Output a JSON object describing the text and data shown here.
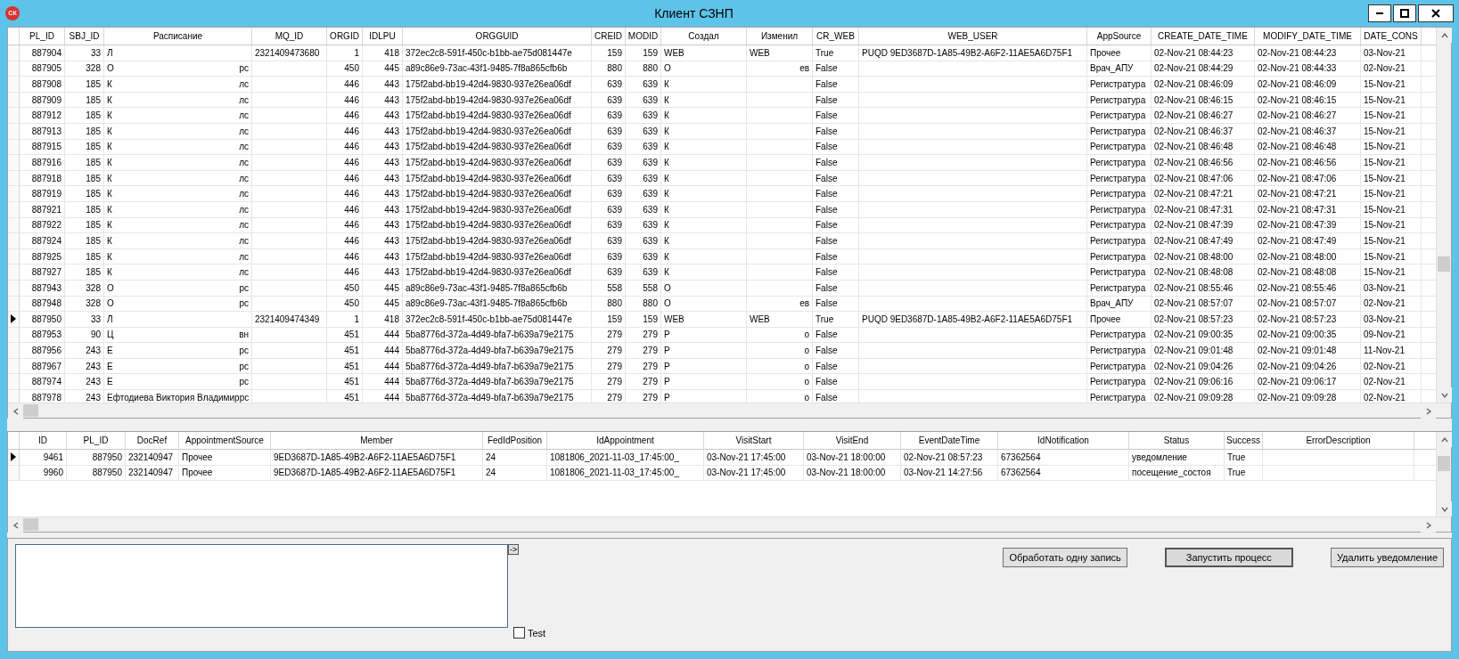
{
  "window": {
    "title": "Клиент СЗНП",
    "app_badge": "СК"
  },
  "top_grid": {
    "columns": [
      "PL_ID",
      "SBJ_ID",
      "Расписание",
      "MQ_ID",
      "ORGID",
      "IDLPU",
      "ORGGUID",
      "CREID",
      "MODID",
      "Создал",
      "Изменил",
      "CR_WEB",
      "WEB_USER",
      "AppSource",
      "CREATE_DATE_TIME",
      "MODIFY_DATE_TIME",
      "DATE_CONS"
    ],
    "rows": [
      {
        "selected": false,
        "cells": [
          "887904",
          "33",
          {
            "start": "Л"
          },
          "2321409473680",
          "1",
          "418",
          "372ec2c8-591f-450c-b1bb-ae75d081447e",
          "159",
          "159",
          {
            "start": "WEB"
          },
          {
            "start": "WEB"
          },
          "True",
          "PUQD 9ED3687D-1A85-49B2-A6F2-11AE5A6D75F1",
          "Прочее",
          "02-Nov-21 08:44:23",
          "02-Nov-21 08:44:23",
          "03-Nov-21"
        ]
      },
      {
        "selected": false,
        "cells": [
          "887905",
          "328",
          {
            "start": "О",
            "end": "рс"
          },
          null,
          "450",
          "445",
          "a89c86e9-73ac-43f1-9485-7f8a865cfb6b",
          "880",
          "880",
          {
            "start": "О"
          },
          {
            "end": "ев"
          },
          "False",
          null,
          "Врач_АПУ",
          "02-Nov-21 08:44:29",
          "02-Nov-21 08:44:33",
          "02-Nov-21"
        ]
      },
      {
        "selected": false,
        "cells": [
          "887908",
          "185",
          {
            "start": "К",
            "end": "лс"
          },
          null,
          "446",
          "443",
          "175f2abd-bb19-42d4-9830-937e26ea06df",
          "639",
          "639",
          {
            "start": "К"
          },
          null,
          "False",
          null,
          "Регистратура",
          "02-Nov-21 08:46:09",
          "02-Nov-21 08:46:09",
          "15-Nov-21"
        ]
      },
      {
        "selected": false,
        "cells": [
          "887909",
          "185",
          {
            "start": "К",
            "end": "лс"
          },
          null,
          "446",
          "443",
          "175f2abd-bb19-42d4-9830-937e26ea06df",
          "639",
          "639",
          {
            "start": "К"
          },
          null,
          "False",
          null,
          "Регистратура",
          "02-Nov-21 08:46:15",
          "02-Nov-21 08:46:15",
          "15-Nov-21"
        ]
      },
      {
        "selected": false,
        "cells": [
          "887912",
          "185",
          {
            "start": "К",
            "end": "лс"
          },
          null,
          "446",
          "443",
          "175f2abd-bb19-42d4-9830-937e26ea06df",
          "639",
          "639",
          {
            "start": "К"
          },
          null,
          "False",
          null,
          "Регистратура",
          "02-Nov-21 08:46:27",
          "02-Nov-21 08:46:27",
          "15-Nov-21"
        ]
      },
      {
        "selected": false,
        "cells": [
          "887913",
          "185",
          {
            "start": "К",
            "end": "лс"
          },
          null,
          "446",
          "443",
          "175f2abd-bb19-42d4-9830-937e26ea06df",
          "639",
          "639",
          {
            "start": "К"
          },
          null,
          "False",
          null,
          "Регистратура",
          "02-Nov-21 08:46:37",
          "02-Nov-21 08:46:37",
          "15-Nov-21"
        ]
      },
      {
        "selected": false,
        "cells": [
          "887915",
          "185",
          {
            "start": "К",
            "end": "лс"
          },
          null,
          "446",
          "443",
          "175f2abd-bb19-42d4-9830-937e26ea06df",
          "639",
          "639",
          {
            "start": "К"
          },
          null,
          "False",
          null,
          "Регистратура",
          "02-Nov-21 08:46:48",
          "02-Nov-21 08:46:48",
          "15-Nov-21"
        ]
      },
      {
        "selected": false,
        "cells": [
          "887916",
          "185",
          {
            "start": "К",
            "end": "лс"
          },
          null,
          "446",
          "443",
          "175f2abd-bb19-42d4-9830-937e26ea06df",
          "639",
          "639",
          {
            "start": "К"
          },
          null,
          "False",
          null,
          "Регистратура",
          "02-Nov-21 08:46:56",
          "02-Nov-21 08:46:56",
          "15-Nov-21"
        ]
      },
      {
        "selected": false,
        "cells": [
          "887918",
          "185",
          {
            "start": "К",
            "end": "лс"
          },
          null,
          "446",
          "443",
          "175f2abd-bb19-42d4-9830-937e26ea06df",
          "639",
          "639",
          {
            "start": "К"
          },
          null,
          "False",
          null,
          "Регистратура",
          "02-Nov-21 08:47:06",
          "02-Nov-21 08:47:06",
          "15-Nov-21"
        ]
      },
      {
        "selected": false,
        "cells": [
          "887919",
          "185",
          {
            "start": "К",
            "end": "лс"
          },
          null,
          "446",
          "443",
          "175f2abd-bb19-42d4-9830-937e26ea06df",
          "639",
          "639",
          {
            "start": "К"
          },
          null,
          "False",
          null,
          "Регистратура",
          "02-Nov-21 08:47:21",
          "02-Nov-21 08:47:21",
          "15-Nov-21"
        ]
      },
      {
        "selected": false,
        "cells": [
          "887921",
          "185",
          {
            "start": "К",
            "end": "лс"
          },
          null,
          "446",
          "443",
          "175f2abd-bb19-42d4-9830-937e26ea06df",
          "639",
          "639",
          {
            "start": "К"
          },
          null,
          "False",
          null,
          "Регистратура",
          "02-Nov-21 08:47:31",
          "02-Nov-21 08:47:31",
          "15-Nov-21"
        ]
      },
      {
        "selected": false,
        "cells": [
          "887922",
          "185",
          {
            "start": "К",
            "end": "лс"
          },
          null,
          "446",
          "443",
          "175f2abd-bb19-42d4-9830-937e26ea06df",
          "639",
          "639",
          {
            "start": "К"
          },
          null,
          "False",
          null,
          "Регистратура",
          "02-Nov-21 08:47:39",
          "02-Nov-21 08:47:39",
          "15-Nov-21"
        ]
      },
      {
        "selected": false,
        "cells": [
          "887924",
          "185",
          {
            "start": "К",
            "end": "лс"
          },
          null,
          "446",
          "443",
          "175f2abd-bb19-42d4-9830-937e26ea06df",
          "639",
          "639",
          {
            "start": "К"
          },
          null,
          "False",
          null,
          "Регистратура",
          "02-Nov-21 08:47:49",
          "02-Nov-21 08:47:49",
          "15-Nov-21"
        ]
      },
      {
        "selected": false,
        "cells": [
          "887925",
          "185",
          {
            "start": "К",
            "end": "лс"
          },
          null,
          "446",
          "443",
          "175f2abd-bb19-42d4-9830-937e26ea06df",
          "639",
          "639",
          {
            "start": "К"
          },
          null,
          "False",
          null,
          "Регистратура",
          "02-Nov-21 08:48:00",
          "02-Nov-21 08:48:00",
          "15-Nov-21"
        ]
      },
      {
        "selected": false,
        "cells": [
          "887927",
          "185",
          {
            "start": "К",
            "end": "лс"
          },
          null,
          "446",
          "443",
          "175f2abd-bb19-42d4-9830-937e26ea06df",
          "639",
          "639",
          {
            "start": "К"
          },
          null,
          "False",
          null,
          "Регистратура",
          "02-Nov-21 08:48:08",
          "02-Nov-21 08:48:08",
          "15-Nov-21"
        ]
      },
      {
        "selected": false,
        "cells": [
          "887943",
          "328",
          {
            "start": "О",
            "end": "рс"
          },
          null,
          "450",
          "445",
          "a89c86e9-73ac-43f1-9485-7f8a865cfb6b",
          "558",
          "558",
          {
            "start": "О"
          },
          null,
          "False",
          null,
          "Регистратура",
          "02-Nov-21 08:55:46",
          "02-Nov-21 08:55:46",
          "03-Nov-21"
        ]
      },
      {
        "selected": false,
        "cells": [
          "887948",
          "328",
          {
            "start": "О",
            "end": "рс"
          },
          null,
          "450",
          "445",
          "a89c86e9-73ac-43f1-9485-7f8a865cfb6b",
          "880",
          "880",
          {
            "start": "О"
          },
          {
            "end": "ев"
          },
          "False",
          null,
          "Врач_АПУ",
          "02-Nov-21 08:57:07",
          "02-Nov-21 08:57:07",
          "02-Nov-21"
        ]
      },
      {
        "selected": true,
        "cells": [
          "887950",
          "33",
          {
            "start": "Л"
          },
          "2321409474349",
          "1",
          "418",
          "372ec2c8-591f-450c-b1bb-ae75d081447e",
          "159",
          "159",
          {
            "start": "WEB"
          },
          {
            "start": "WEB"
          },
          "True",
          "PUQD 9ED3687D-1A85-49B2-A6F2-11AE5A6D75F1",
          "Прочее",
          "02-Nov-21 08:57:23",
          "02-Nov-21 08:57:23",
          "03-Nov-21"
        ]
      },
      {
        "selected": false,
        "cells": [
          "887953",
          "90",
          {
            "start": "Ц",
            "end": "вн"
          },
          null,
          "451",
          "444",
          "5ba8776d-372a-4d49-bfa7-b639a79e2175",
          "279",
          "279",
          {
            "start": "Р"
          },
          {
            "end": "о"
          },
          "False",
          null,
          "Регистратура",
          "02-Nov-21 09:00:35",
          "02-Nov-21 09:00:35",
          "09-Nov-21"
        ]
      },
      {
        "selected": false,
        "cells": [
          "887956",
          "243",
          {
            "start": "Е",
            "end": "рс"
          },
          null,
          "451",
          "444",
          "5ba8776d-372a-4d49-bfa7-b639a79e2175",
          "279",
          "279",
          {
            "start": "Р"
          },
          {
            "end": "о"
          },
          "False",
          null,
          "Регистратура",
          "02-Nov-21 09:01:48",
          "02-Nov-21 09:01:48",
          "11-Nov-21"
        ]
      },
      {
        "selected": false,
        "cells": [
          "887967",
          "243",
          {
            "start": "Е",
            "end": "рс"
          },
          null,
          "451",
          "444",
          "5ba8776d-372a-4d49-bfa7-b639a79e2175",
          "279",
          "279",
          {
            "start": "Р"
          },
          {
            "end": "о"
          },
          "False",
          null,
          "Регистратура",
          "02-Nov-21 09:04:26",
          "02-Nov-21 09:04:26",
          "02-Nov-21"
        ]
      },
      {
        "selected": false,
        "cells": [
          "887974",
          "243",
          {
            "start": "Е",
            "end": "рс"
          },
          null,
          "451",
          "444",
          "5ba8776d-372a-4d49-bfa7-b639a79e2175",
          "279",
          "279",
          {
            "start": "Р"
          },
          {
            "end": "о"
          },
          "False",
          null,
          "Регистратура",
          "02-Nov-21 09:06:16",
          "02-Nov-21 09:06:17",
          "02-Nov-21"
        ]
      },
      {
        "selected": false,
        "cells": [
          "887978",
          "243",
          {
            "start": "Ефтодиева Виктория Владимир",
            "end": "рс"
          },
          null,
          "451",
          "444",
          "5ba8776d-372a-4d49-bfa7-b639a79e2175",
          "279",
          "279",
          {
            "start": "Р"
          },
          {
            "end": "о"
          },
          "False",
          null,
          "Регистратура",
          "02-Nov-21 09:09:28",
          "02-Nov-21 09:09:28",
          "02-Nov-21"
        ]
      }
    ]
  },
  "bottom_grid": {
    "columns": [
      "ID",
      "PL_ID",
      "DocRef",
      "AppointmentSource",
      "Member",
      "FedIdPosition",
      "IdAppointment",
      "VisitStart",
      "VisitEnd",
      "EventDateTime",
      "IdNotification",
      "Status",
      "Success",
      "ErrorDescription"
    ],
    "rows": [
      {
        "selected": true,
        "cells": [
          "9461",
          "887950",
          "232140947",
          "Прочее",
          "9ED3687D-1A85-49B2-A6F2-11AE5A6D75F1",
          "24",
          "1081806_2021-11-03_17:45:00_",
          "03-Nov-21 17:45:00",
          "03-Nov-21 18:00:00",
          "02-Nov-21 08:57:23",
          "67362564",
          "уведомление",
          "True",
          null
        ]
      },
      {
        "selected": false,
        "cells": [
          "9960",
          "887950",
          "232140947",
          "Прочее",
          "9ED3687D-1A85-49B2-A6F2-11AE5A6D75F1",
          "24",
          "1081806_2021-11-03_17:45:00_",
          "03-Nov-21 17:45:00",
          "03-Nov-21 18:00:00",
          "03-Nov-21 14:27:56",
          "67362564",
          "посещение_состоя",
          "True",
          null
        ]
      }
    ]
  },
  "controls": {
    "arrow_button": "->",
    "test_checkbox": {
      "label": "Test",
      "checked": false
    },
    "buttons": [
      {
        "label": "Обработать одну запись",
        "pressed": false
      },
      {
        "label": "Запустить процесс",
        "pressed": true
      },
      {
        "label": "Удалить уведомление",
        "pressed": false
      }
    ]
  }
}
